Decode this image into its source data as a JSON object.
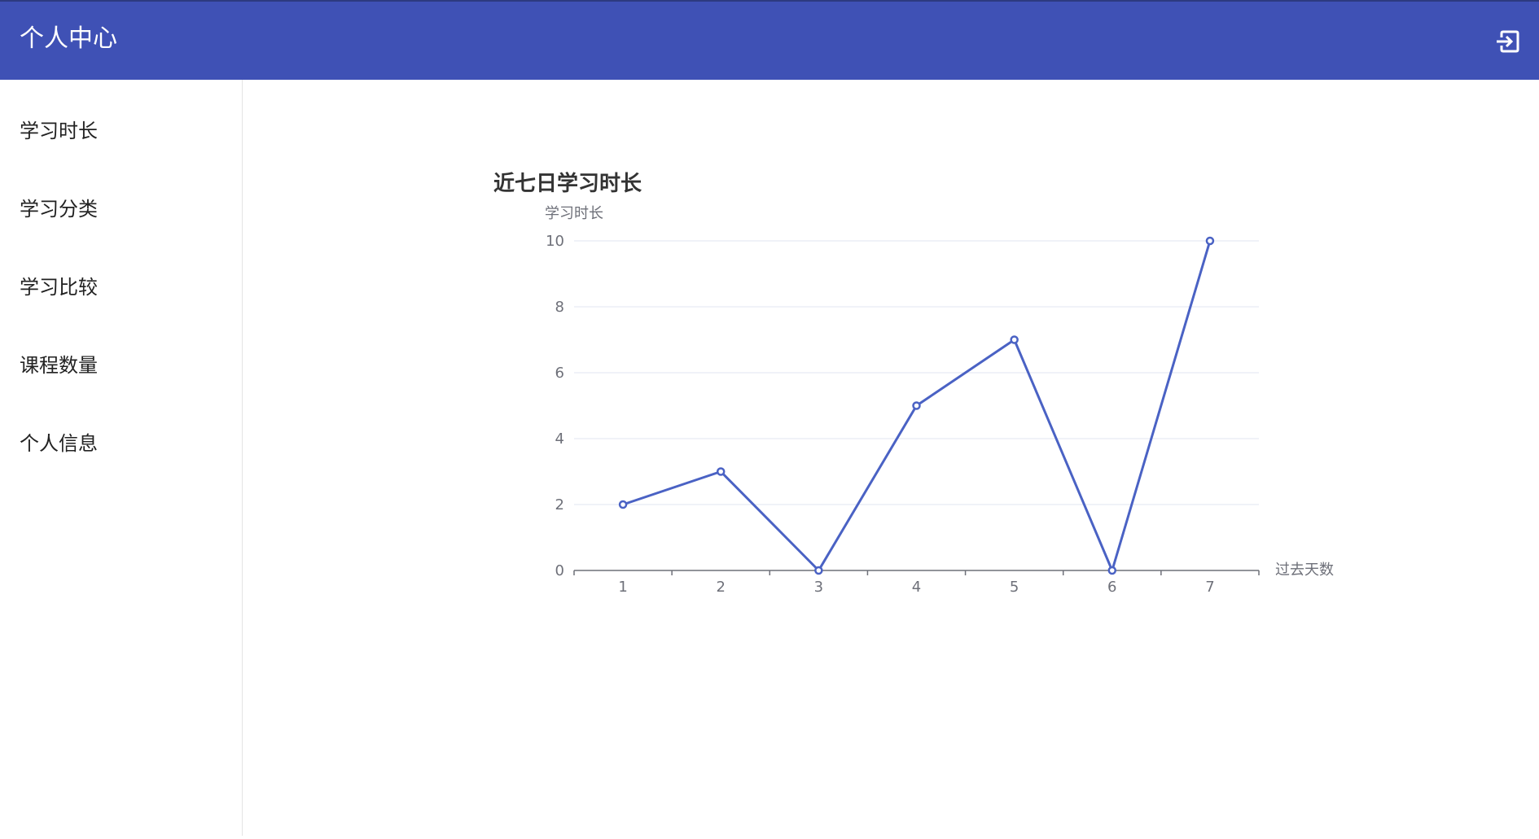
{
  "header": {
    "title": "个人中心",
    "logout_icon": "logout-icon",
    "background": "#3f51b5"
  },
  "sidebar": {
    "items": [
      {
        "label": "学习时长"
      },
      {
        "label": "学习分类"
      },
      {
        "label": "学习比较"
      },
      {
        "label": "课程数量"
      },
      {
        "label": "个人信息"
      }
    ]
  },
  "chart_data": {
    "type": "line",
    "title": "近七日学习时长",
    "ylabel": "学习时长",
    "xlabel": "过去天数",
    "categories": [
      "1",
      "2",
      "3",
      "4",
      "5",
      "6",
      "7"
    ],
    "values": [
      2,
      3,
      0,
      5,
      7,
      0,
      10
    ],
    "ylim": [
      0,
      10
    ],
    "yticks": [
      0,
      2,
      4,
      6,
      8,
      10
    ],
    "grid": true,
    "line_color": "#4a62c4"
  }
}
